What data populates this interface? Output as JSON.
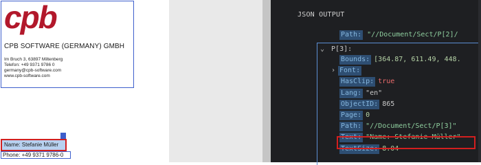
{
  "document": {
    "logo_text": "cpb",
    "company_name": "CPB SOFTWARE (GERMANY) GMBH",
    "address_lines": [
      "Im Bruch 3, 63897 Miltenberg",
      "Telefon: +49 9371 9786 0",
      "germany@cpb-software.com",
      "www.cpb-software.com"
    ],
    "name_line": "Name:  Stefanie Müller",
    "phone_line": "Phone: +49 9371 9786-0"
  },
  "json_output": {
    "title": "JSON OUTPUT",
    "prev_path": {
      "key": "Path:",
      "value": "\"//Document/Sect/P[2]/"
    },
    "p3_label": "P[3]:",
    "fields": [
      {
        "key": "Bounds:",
        "value": "[364.87, 611.49, 448.",
        "kind": "num",
        "indent": 1
      },
      {
        "key": "Font:",
        "value": "",
        "kind": "none",
        "indent": 1,
        "expandable": true
      },
      {
        "key": "HasClip:",
        "value": "true",
        "kind": "bool",
        "indent": 1
      },
      {
        "key": "Lang:",
        "value": "\"en\"",
        "kind": "plain",
        "indent": 1
      },
      {
        "key": "ObjectID:",
        "value": "865",
        "kind": "plain",
        "indent": 1
      },
      {
        "key": "Page:",
        "value": "0",
        "kind": "num",
        "indent": 1
      },
      {
        "key": "Path:",
        "value": "\"//Document/Sect/P[3]\"",
        "kind": "str",
        "indent": 1
      },
      {
        "key": "Text:",
        "value": "\"Name: Stefanie Müller\"",
        "kind": "str",
        "indent": 1
      },
      {
        "key": "TextSize:",
        "value": "8.04",
        "kind": "num",
        "indent": 1
      }
    ]
  },
  "colors": {
    "highlight_red": "#d31f1f",
    "selection_blue": "#3d5fcc",
    "json_key_bg": "#2e4e72",
    "json_bg": "#1e1f22"
  }
}
